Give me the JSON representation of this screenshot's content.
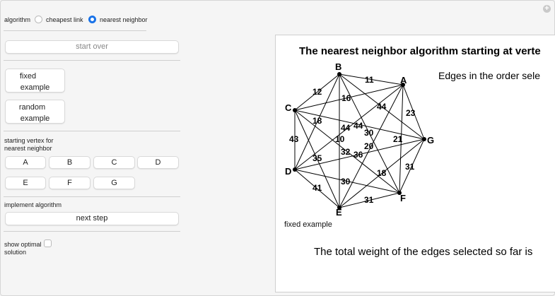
{
  "controls": {
    "algorithm_label": "algorithm",
    "option_cheapest": "cheapest link",
    "option_nearest": "nearest neighbor",
    "selected": "nearest neighbor",
    "start_over": "start over",
    "fixed_example": [
      "fixed",
      "example"
    ],
    "random_example": [
      "random",
      "example"
    ],
    "starting_vertex_label": [
      "starting vertex for",
      "nearest neighbor"
    ],
    "vertex_buttons": [
      "A",
      "B",
      "C",
      "D",
      "E",
      "F",
      "G"
    ],
    "implement_label": "implement algorithm",
    "next_step": "next step",
    "show_optimal_label": [
      "show optimal",
      "solution"
    ],
    "show_optimal_checked": false
  },
  "panel": {
    "title": "The nearest neighbor algorithm starting at verte",
    "edges_label": "Edges in the order sele",
    "example_label": "fixed example",
    "total_label": "The total weight of the edges selected so far is"
  },
  "graph": {
    "vertices": [
      "A",
      "B",
      "C",
      "D",
      "E",
      "F",
      "G"
    ],
    "edge_weights": [
      "11",
      "12",
      "16",
      "44",
      "23",
      "18",
      "44",
      "44",
      "30",
      "43",
      "10",
      "21",
      "20",
      "35",
      "32",
      "36",
      "31",
      "18",
      "41",
      "30",
      "31"
    ]
  }
}
